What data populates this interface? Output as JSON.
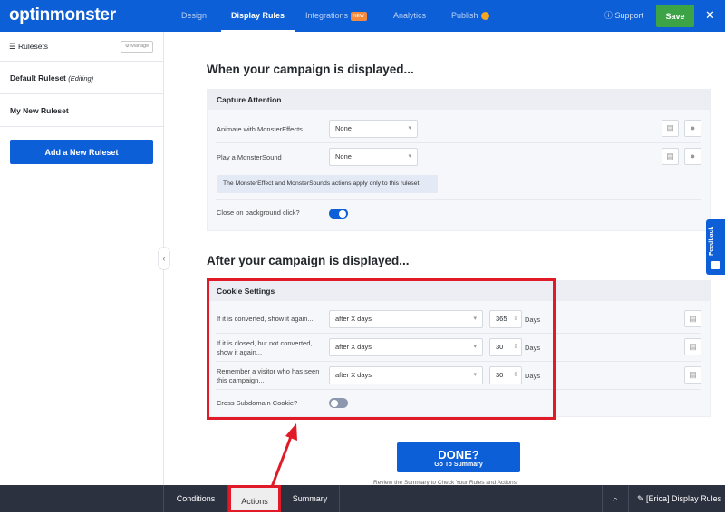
{
  "header": {
    "logo": "optinmonster",
    "tabs": [
      {
        "label": "Design"
      },
      {
        "label": "Display Rules",
        "active": true
      },
      {
        "label": "Integrations",
        "badge": "NEW"
      },
      {
        "label": "Analytics"
      },
      {
        "label": "Publish"
      }
    ],
    "support": "Support",
    "save": "Save",
    "close": "✕"
  },
  "sidebar": {
    "title": "Rulesets",
    "manage": "Manage",
    "rulesets": [
      {
        "name": "Default Ruleset",
        "note": "(Editing)"
      },
      {
        "name": "My New Ruleset"
      }
    ],
    "add": "Add a New Ruleset"
  },
  "main": {
    "section1": "When your campaign is displayed...",
    "capture": {
      "title": "Capture Attention",
      "rows": [
        {
          "label": "Animate with MonsterEffects",
          "value": "None"
        },
        {
          "label": "Play a MonsterSound",
          "value": "None"
        }
      ],
      "info": "The MonsterEffect and MonsterSounds actions apply only to this ruleset.",
      "toggle_label": "Close on background click?",
      "toggle_on": true
    },
    "section2": "After your campaign is displayed...",
    "cookie": {
      "title": "Cookie Settings",
      "rows": [
        {
          "label": "If it is converted, show it again...",
          "value": "after X days",
          "days": "365",
          "unit": "Days"
        },
        {
          "label": "If it is closed, but not converted, show it again...",
          "value": "after X days",
          "days": "30",
          "unit": "Days"
        },
        {
          "label": "Remember a visitor who has seen this campaign...",
          "value": "after X days",
          "days": "30",
          "unit": "Days"
        }
      ],
      "toggle_label": "Cross Subdomain Cookie?",
      "toggle_on": false
    },
    "done": {
      "title": "DONE?",
      "subtitle": "Go To Summary",
      "note": "Review the Summary to Check Your Rules and Actions"
    }
  },
  "bottom": {
    "tabs": [
      {
        "label": "Conditions"
      },
      {
        "label": "Actions",
        "active": true
      },
      {
        "label": "Summary"
      }
    ],
    "campaign": "[Erica] Display Rules"
  },
  "feedback": "Feedback",
  "colors": {
    "brand": "#0d5fd8",
    "save": "#3ca447",
    "highlight": "#e11a27"
  }
}
